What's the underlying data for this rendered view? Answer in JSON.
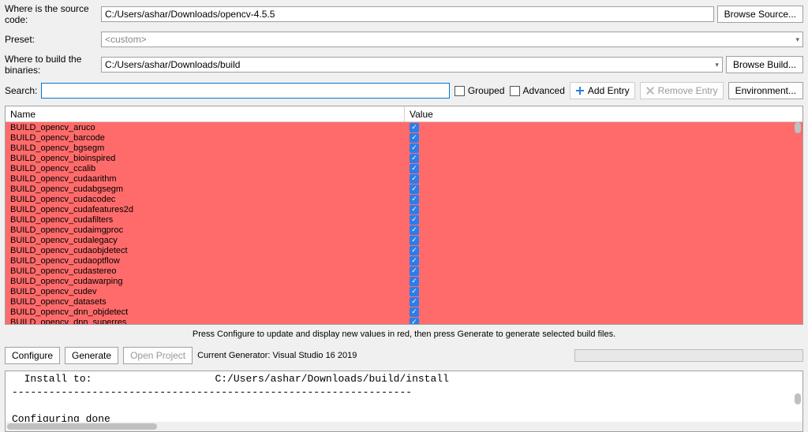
{
  "form": {
    "source_label": "Where is the source code:",
    "source_value": "C:/Users/ashar/Downloads/opencv-4.5.5",
    "browse_source": "Browse Source...",
    "preset_label": "Preset:",
    "preset_value": "<custom>",
    "build_label": "Where to build the binaries:",
    "build_value": "C:/Users/ashar/Downloads/build",
    "browse_build": "Browse Build..."
  },
  "toolbar": {
    "search_label": "Search:",
    "search_value": "",
    "grouped_label": "Grouped",
    "advanced_label": "Advanced",
    "add_entry": "Add Entry",
    "remove_entry": "Remove Entry",
    "environment": "Environment..."
  },
  "table": {
    "col_name": "Name",
    "col_value": "Value",
    "rows": [
      {
        "name": "BUILD_opencv_aruco",
        "checked": true
      },
      {
        "name": "BUILD_opencv_barcode",
        "checked": true
      },
      {
        "name": "BUILD_opencv_bgsegm",
        "checked": true
      },
      {
        "name": "BUILD_opencv_bioinspired",
        "checked": true
      },
      {
        "name": "BUILD_opencv_ccalib",
        "checked": true
      },
      {
        "name": "BUILD_opencv_cudaarithm",
        "checked": true
      },
      {
        "name": "BUILD_opencv_cudabgsegm",
        "checked": true
      },
      {
        "name": "BUILD_opencv_cudacodec",
        "checked": true
      },
      {
        "name": "BUILD_opencv_cudafeatures2d",
        "checked": true
      },
      {
        "name": "BUILD_opencv_cudafilters",
        "checked": true
      },
      {
        "name": "BUILD_opencv_cudaimgproc",
        "checked": true
      },
      {
        "name": "BUILD_opencv_cudalegacy",
        "checked": true
      },
      {
        "name": "BUILD_opencv_cudaobjdetect",
        "checked": true
      },
      {
        "name": "BUILD_opencv_cudaoptflow",
        "checked": true
      },
      {
        "name": "BUILD_opencv_cudastereo",
        "checked": true
      },
      {
        "name": "BUILD_opencv_cudawarping",
        "checked": true
      },
      {
        "name": "BUILD_opencv_cudev",
        "checked": true
      },
      {
        "name": "BUILD_opencv_datasets",
        "checked": true
      },
      {
        "name": "BUILD_opencv_dnn_objdetect",
        "checked": true
      },
      {
        "name": "BUILD_opencv_dnn_superres",
        "checked": true
      }
    ]
  },
  "hint": "Press Configure to update and display new values in red, then press Generate to generate selected build files.",
  "bottom": {
    "configure": "Configure",
    "generate": "Generate",
    "open_project": "Open Project",
    "generator": "Current Generator: Visual Studio 16 2019"
  },
  "log": {
    "text": "  Install to:                    C:/Users/ashar/Downloads/build/install\n-----------------------------------------------------------------\n\nConfiguring done"
  }
}
